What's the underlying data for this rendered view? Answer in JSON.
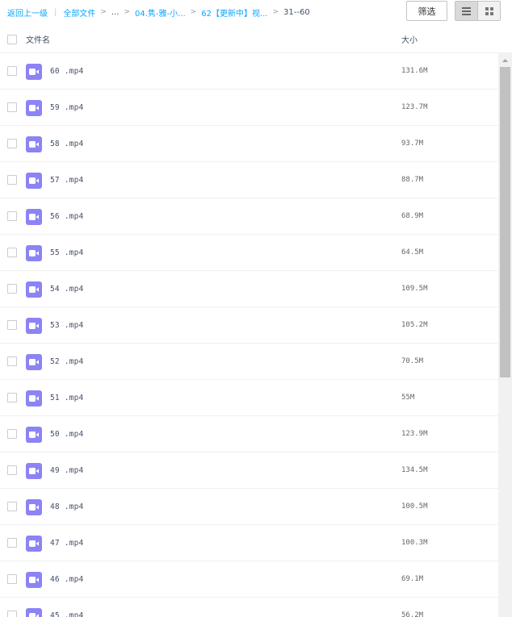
{
  "breadcrumb": {
    "back": "返回上一级",
    "all_files": "全部文件",
    "ellipsis": "...",
    "level1": "04.隽-雅-小...",
    "level2": "62【更新中】视...",
    "current": "31--60"
  },
  "toolbar": {
    "filter_label": "筛选",
    "view_modes": [
      "list-view-icon",
      "grid-view-icon"
    ]
  },
  "header": {
    "name_label": "文件名",
    "size_label": "大小"
  },
  "files": [
    {
      "name": "60 .mp4",
      "size": "131.6M"
    },
    {
      "name": "59 .mp4",
      "size": "123.7M"
    },
    {
      "name": "58 .mp4",
      "size": "93.7M"
    },
    {
      "name": "57 .mp4",
      "size": "88.7M"
    },
    {
      "name": "56 .mp4",
      "size": "68.9M"
    },
    {
      "name": "55 .mp4",
      "size": "64.5M"
    },
    {
      "name": "54 .mp4",
      "size": "109.5M"
    },
    {
      "name": "53 .mp4",
      "size": "105.2M"
    },
    {
      "name": "52 .mp4",
      "size": "70.5M"
    },
    {
      "name": "51 .mp4",
      "size": "55M"
    },
    {
      "name": "50 .mp4",
      "size": "123.9M"
    },
    {
      "name": "49 .mp4",
      "size": "134.5M"
    },
    {
      "name": "48 .mp4",
      "size": "100.5M"
    },
    {
      "name": "47 .mp4",
      "size": "100.3M"
    },
    {
      "name": "46 .mp4",
      "size": "69.1M"
    },
    {
      "name": "45 .mp4",
      "size": "56.2M"
    }
  ],
  "colors": {
    "link": "#06a7ff",
    "video_icon": "#8c83f5"
  }
}
